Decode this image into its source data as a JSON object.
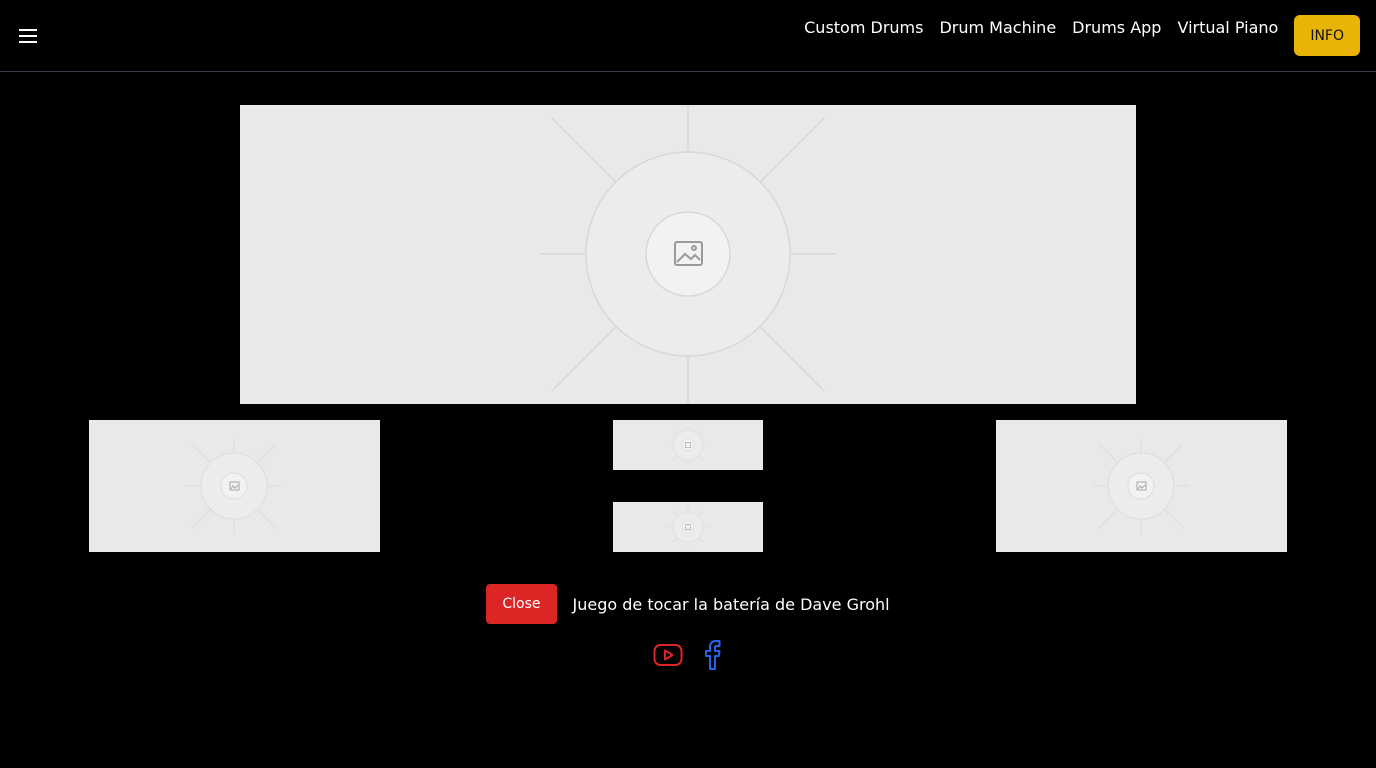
{
  "header": {
    "menu_icon": "hamburger-menu-icon",
    "nav_links": [
      {
        "label": "Custom Drums"
      },
      {
        "label": "Drum Machine"
      },
      {
        "label": "Drums App"
      },
      {
        "label": "Virtual Piano"
      }
    ],
    "info_label": "INFO"
  },
  "gallery": {
    "placeholder_icon": "image-placeholder-icon"
  },
  "footer": {
    "close_label": "Close",
    "caption": "Juego de tocar la batería de Dave Grohl",
    "social": [
      {
        "icon": "youtube-icon",
        "color": "#dc2626"
      },
      {
        "icon": "facebook-icon",
        "color": "#2563eb"
      }
    ]
  },
  "colors": {
    "accent": "#eab308",
    "danger": "#dc2626",
    "background": "#000000",
    "placeholder": "#e9e9e9"
  }
}
